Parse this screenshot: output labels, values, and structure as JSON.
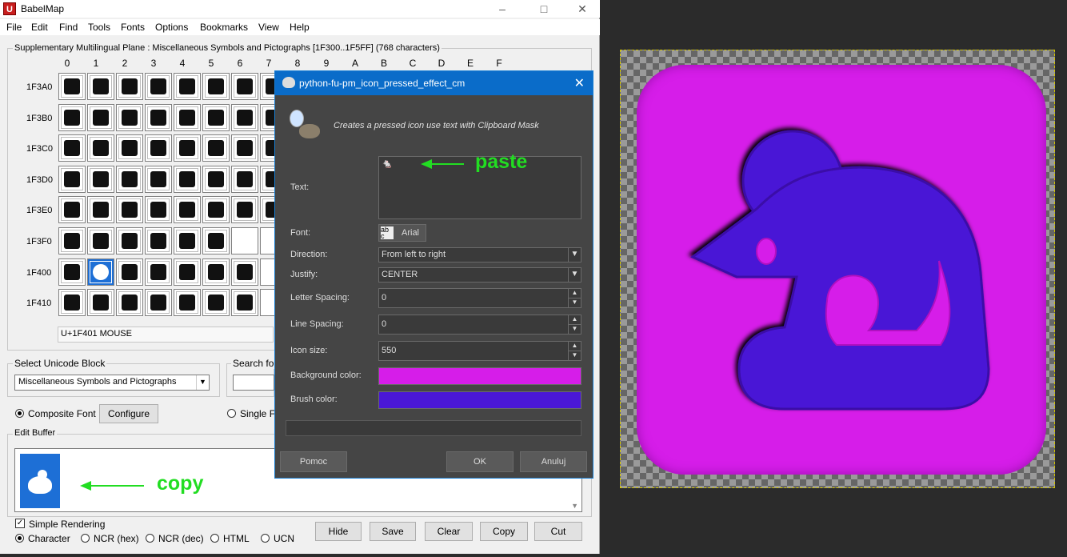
{
  "babelmap": {
    "title": "BabelMap",
    "menu": [
      "File",
      "Edit",
      "Find",
      "Tools",
      "Fonts",
      "Options",
      "Bookmarks",
      "View",
      "Help"
    ],
    "plane_label": "Supplementary Multilingual Plane : Miscellaneous Symbols and Pictographs [1F300..1F5FF] (768 characters)",
    "col_headers": [
      "0",
      "1",
      "2",
      "3",
      "4",
      "5",
      "6",
      "7",
      "8",
      "9",
      "A",
      "B",
      "C",
      "D",
      "E",
      "F"
    ],
    "row_headers": [
      "1F3A0",
      "1F3B0",
      "1F3C0",
      "1F3D0",
      "1F3E0",
      "1F3F0",
      "1F400",
      "1F410"
    ],
    "char_info": "U+1F401 MOUSE",
    "block_group_label": "Select Unicode Block",
    "block_value": "Miscellaneous Symbols and Pictographs",
    "search_label": "Search for",
    "composite_font": "Composite Font",
    "configure_label": "Configure",
    "single_font": "Single Fo",
    "edit_buffer_label": "Edit Buffer",
    "simple_rendering": "Simple Rendering",
    "output_modes": [
      "Character",
      "NCR (hex)",
      "NCR (dec)",
      "HTML",
      "UCN"
    ],
    "buttons": {
      "hide": "Hide",
      "save": "Save",
      "clear": "Clear",
      "copy": "Copy",
      "cut": "Cut"
    }
  },
  "annotations": {
    "paste": "paste",
    "copy": "copy"
  },
  "dialog": {
    "title": "python-fu-pm_icon_pressed_effect_cm",
    "description": "Creates a pressed icon use text with Clipboard Mask",
    "text_label": "Text:",
    "text_value": "🐁",
    "font_label": "Font:",
    "font_value": "Arial",
    "direction_label": "Direction:",
    "direction_value": "From left to right",
    "justify_label": "Justify:",
    "justify_value": "CENTER",
    "letter_spacing_label": "Letter Spacing:",
    "letter_spacing_value": "0",
    "line_spacing_label": "Line Spacing:",
    "line_spacing_value": "0",
    "icon_size_label": "Icon size:",
    "icon_size_value": "550",
    "bg_color_label": "Background color:",
    "bg_color": "#d61de9",
    "brush_color_label": "Brush color:",
    "brush_color": "#4a17d6",
    "help_label": "Pomoc",
    "ok_label": "OK",
    "cancel_label": "Anuluj"
  }
}
